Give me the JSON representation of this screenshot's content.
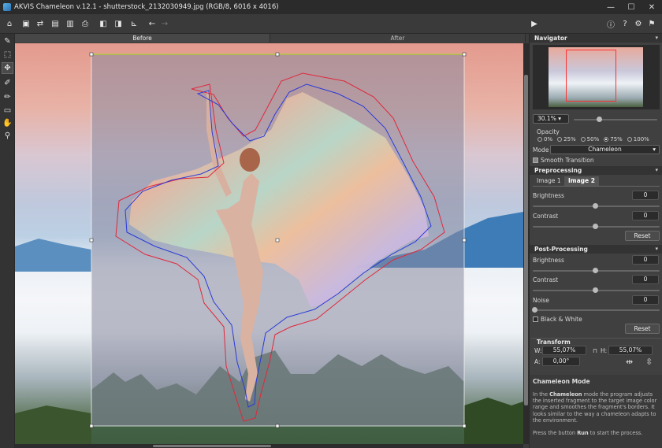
{
  "window": {
    "title": "AKVIS Chameleon v.12.1 - shutterstock_2132030949.jpg (RGB/8, 6016 x 4016)",
    "minimize": "—",
    "maximize": "☐",
    "close": "✕"
  },
  "toolbar": {
    "icons": [
      "home-icon",
      "open-icon",
      "swap-icon",
      "save-icon",
      "save-as-icon",
      "print-icon",
      "export-icon",
      "plugin-icon",
      "ruler-icon",
      "undo-icon",
      "redo-icon",
      "run-icon",
      "info-icon",
      "help-icon",
      "settings-icon",
      "feedback-icon"
    ]
  },
  "view_tabs": {
    "before": "Before",
    "after": "After"
  },
  "navigator": {
    "title": "Navigator",
    "zoom": "30.1%",
    "zoom_fraction": 0.3
  },
  "opacity": {
    "label": "Opacity",
    "options": [
      "0%",
      "25%",
      "50%",
      "75%",
      "100%"
    ],
    "selected": "75%"
  },
  "mode": {
    "label": "Mode",
    "value": "Chameleon",
    "smooth_transition": "Smooth Transition",
    "smooth_checked": true
  },
  "preprocessing": {
    "title": "Preprocessing",
    "tab1": "Image 1",
    "tab2": "Image 2",
    "brightness_label": "Brightness",
    "brightness": "0",
    "contrast_label": "Contrast",
    "contrast": "0",
    "reset": "Reset"
  },
  "postprocessing": {
    "title": "Post-Processing",
    "brightness_label": "Brightness",
    "brightness": "0",
    "contrast_label": "Contrast",
    "contrast": "0",
    "noise_label": "Noise",
    "noise": "0",
    "bw_label": "Black & White",
    "reset": "Reset"
  },
  "transform": {
    "title": "Transform",
    "w_label": "W:",
    "w": "55,07%",
    "h_label": "H:",
    "h": "55,07%",
    "a_label": "A:",
    "a": "0,00°"
  },
  "help": {
    "title": "Chameleon Mode",
    "p1_pre": "In the ",
    "p1_bold": "Chameleon",
    "p1_post": " mode the program adjusts the inserted fragment to the target image color range and smoothes the fragment's borders. It looks similar to the way a chameleon adapts to the environment.",
    "p2_pre": "Press the button ",
    "p2_bold": "Run",
    "p2_post": " to start the process."
  },
  "colors": {
    "selection_red": "#e0283c",
    "selection_blue": "#2a3ad8",
    "frame_green": "#a8d030"
  }
}
